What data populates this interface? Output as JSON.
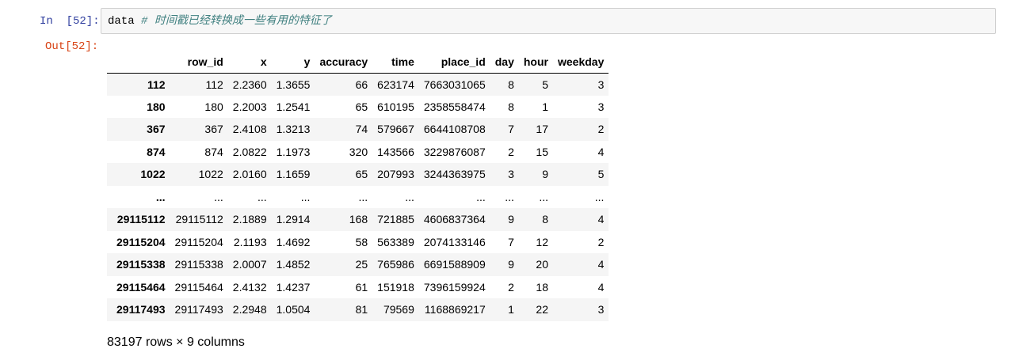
{
  "cell": {
    "in_prompt": "In  [52]:",
    "out_prompt": "Out[52]:",
    "code_ident": "data",
    "code_comment": "# 时间戳已经转换成一些有用的特征了"
  },
  "dataframe": {
    "columns": [
      "row_id",
      "x",
      "y",
      "accuracy",
      "time",
      "place_id",
      "day",
      "hour",
      "weekday"
    ],
    "rows": [
      {
        "index": "112",
        "cells": [
          "112",
          "2.2360",
          "1.3655",
          "66",
          "623174",
          "7663031065",
          "8",
          "5",
          "3"
        ]
      },
      {
        "index": "180",
        "cells": [
          "180",
          "2.2003",
          "1.2541",
          "65",
          "610195",
          "2358558474",
          "8",
          "1",
          "3"
        ]
      },
      {
        "index": "367",
        "cells": [
          "367",
          "2.4108",
          "1.3213",
          "74",
          "579667",
          "6644108708",
          "7",
          "17",
          "2"
        ]
      },
      {
        "index": "874",
        "cells": [
          "874",
          "2.0822",
          "1.1973",
          "320",
          "143566",
          "3229876087",
          "2",
          "15",
          "4"
        ]
      },
      {
        "index": "1022",
        "cells": [
          "1022",
          "2.0160",
          "1.1659",
          "65",
          "207993",
          "3244363975",
          "3",
          "9",
          "5"
        ]
      },
      {
        "index": "...",
        "cells": [
          "...",
          "...",
          "...",
          "...",
          "...",
          "...",
          "...",
          "...",
          "..."
        ]
      },
      {
        "index": "29115112",
        "cells": [
          "29115112",
          "2.1889",
          "1.2914",
          "168",
          "721885",
          "4606837364",
          "9",
          "8",
          "4"
        ]
      },
      {
        "index": "29115204",
        "cells": [
          "29115204",
          "2.1193",
          "1.4692",
          "58",
          "563389",
          "2074133146",
          "7",
          "12",
          "2"
        ]
      },
      {
        "index": "29115338",
        "cells": [
          "29115338",
          "2.0007",
          "1.4852",
          "25",
          "765986",
          "6691588909",
          "9",
          "20",
          "4"
        ]
      },
      {
        "index": "29115464",
        "cells": [
          "29115464",
          "2.4132",
          "1.4237",
          "61",
          "151918",
          "7396159924",
          "2",
          "18",
          "4"
        ]
      },
      {
        "index": "29117493",
        "cells": [
          "29117493",
          "2.2948",
          "1.0504",
          "81",
          "79569",
          "1168869217",
          "1",
          "22",
          "3"
        ]
      }
    ],
    "shape_text": "83197 rows × 9 columns"
  }
}
